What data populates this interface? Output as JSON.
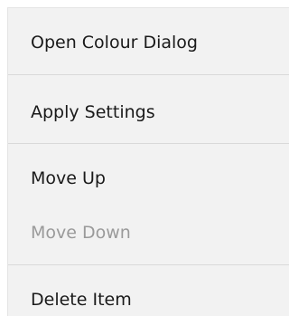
{
  "context_menu": {
    "items": [
      {
        "label": "Open Colour Dialog",
        "enabled": true
      },
      {
        "label": "Apply Settings",
        "enabled": true
      },
      {
        "label": "Move Up",
        "enabled": true
      },
      {
        "label": "Move Down",
        "enabled": false
      },
      {
        "label": "Delete Item",
        "enabled": true
      }
    ]
  }
}
